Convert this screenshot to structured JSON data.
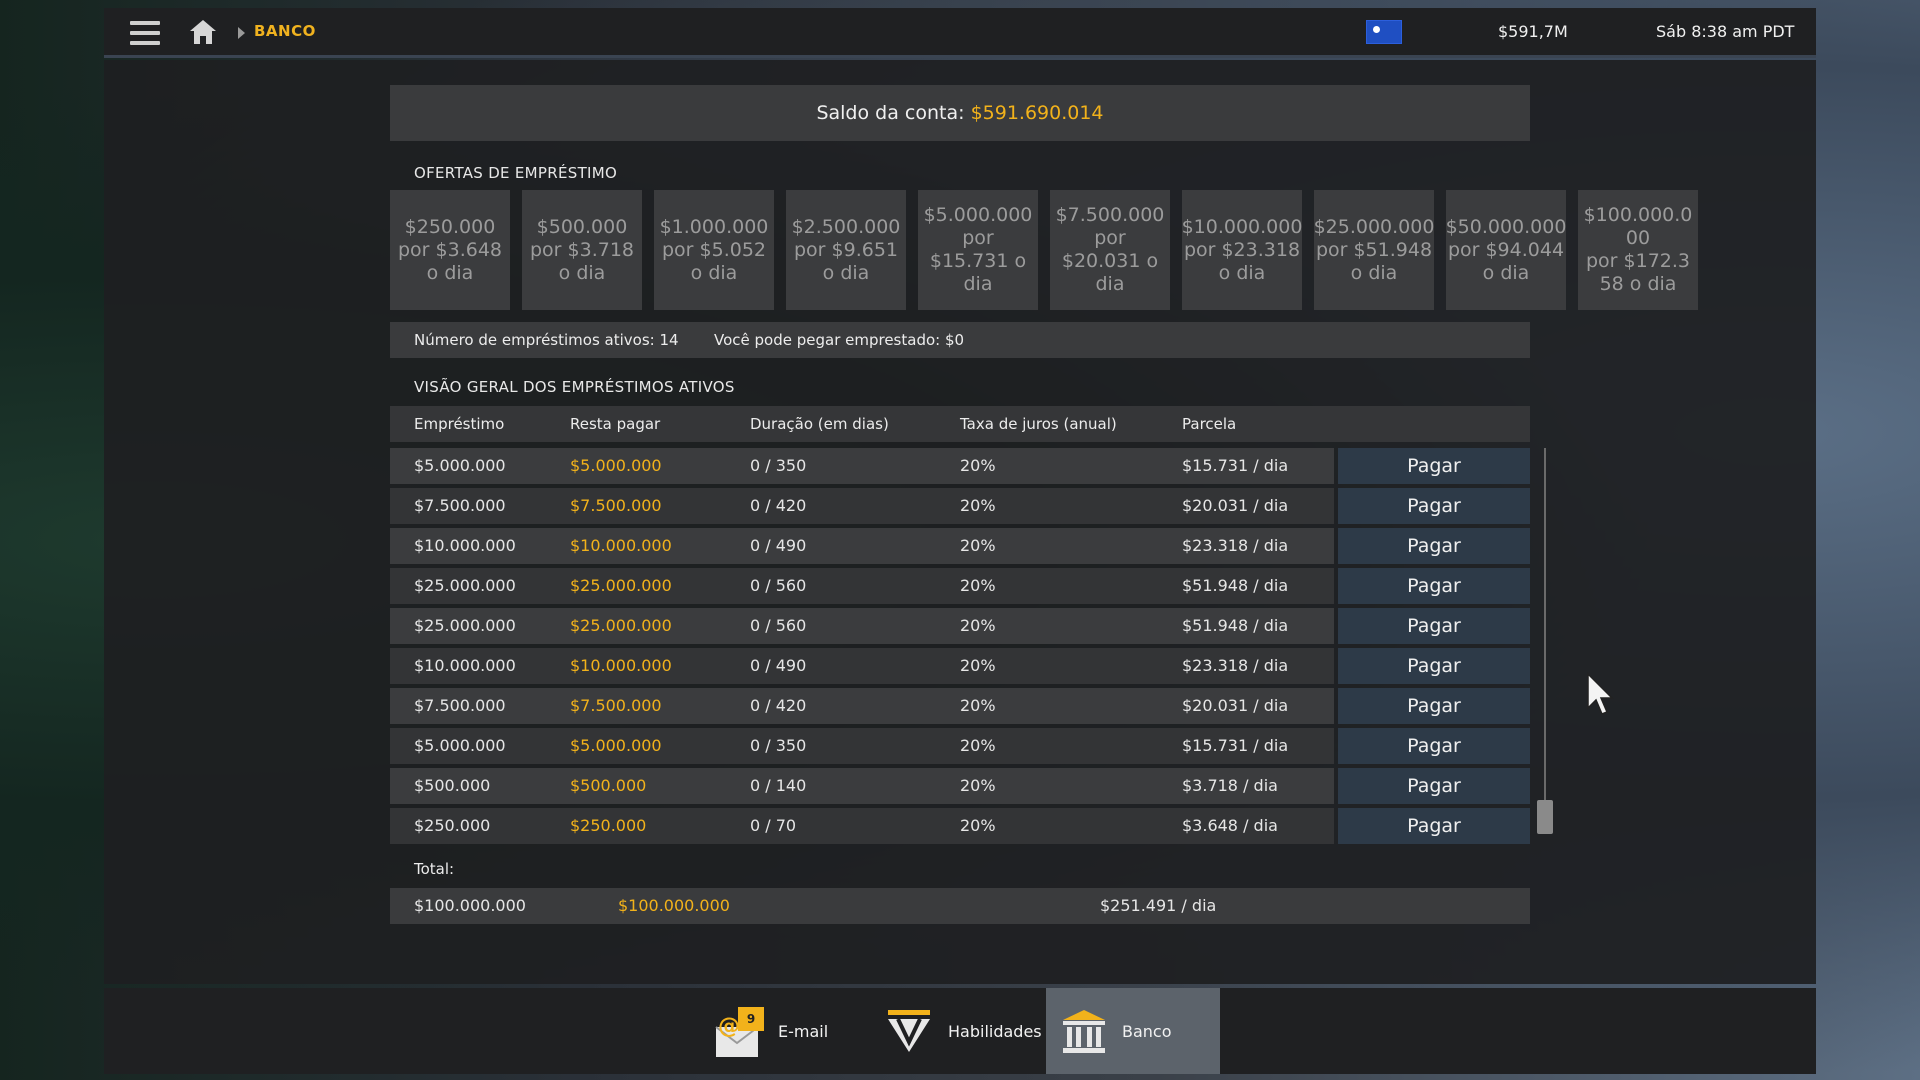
{
  "topbar": {
    "breadcrumb": "BANCO",
    "money": "$591,7M",
    "clock": "Sáb 8:38 am PDT"
  },
  "account": {
    "balance_label": "Saldo da conta: ",
    "balance_value": "$591.690.014"
  },
  "offers_section": {
    "title": "OFERTAS DE EMPRÉSTIMO",
    "offers": [
      {
        "amount": "$250.000",
        "rate": "por $3.648 o dia"
      },
      {
        "amount": "$500.000",
        "rate": "por $3.718 o dia"
      },
      {
        "amount": "$1.000.000",
        "rate": "por $5.052 o dia"
      },
      {
        "amount": "$2.500.000",
        "rate": "por $9.651 o dia"
      },
      {
        "amount": "$5.000.000",
        "rate": "por $15.731 o dia"
      },
      {
        "amount": "$7.500.000",
        "rate": "por $20.031 o dia"
      },
      {
        "amount": "$10.000.000",
        "rate": "por $23.318 o dia"
      },
      {
        "amount": "$25.000.000",
        "rate": "por $51.948 o dia"
      },
      {
        "amount": "$50.000.000",
        "rate": "por $94.044 o dia"
      },
      {
        "amount": "$100.000.000",
        "rate": "por $172.358 o dia"
      }
    ]
  },
  "info": {
    "active_loans": "Número de empréstimos ativos: 14",
    "can_borrow": "Você pode pegar emprestado: $0"
  },
  "loans_section": {
    "title": "VISÃO GERAL DOS EMPRÉSTIMOS ATIVOS",
    "headers": [
      "Empréstimo",
      "Resta pagar",
      "Duração (em dias)",
      "Taxa de juros (anual)",
      "Parcela"
    ],
    "pay_label": "Pagar",
    "rows": [
      [
        "$5.000.000",
        "$5.000.000",
        "0 / 350",
        "20%",
        "$15.731 / dia"
      ],
      [
        "$7.500.000",
        "$7.500.000",
        "0 / 420",
        "20%",
        "$20.031 / dia"
      ],
      [
        "$10.000.000",
        "$10.000.000",
        "0 / 490",
        "20%",
        "$23.318 / dia"
      ],
      [
        "$25.000.000",
        "$25.000.000",
        "0 / 560",
        "20%",
        "$51.948 / dia"
      ],
      [
        "$25.000.000",
        "$25.000.000",
        "0 / 560",
        "20%",
        "$51.948 / dia"
      ],
      [
        "$10.000.000",
        "$10.000.000",
        "0 / 490",
        "20%",
        "$23.318 / dia"
      ],
      [
        "$7.500.000",
        "$7.500.000",
        "0 / 420",
        "20%",
        "$20.031 / dia"
      ],
      [
        "$5.000.000",
        "$5.000.000",
        "0 / 350",
        "20%",
        "$15.731 / dia"
      ],
      [
        "$500.000",
        "$500.000",
        "0 / 140",
        "20%",
        "$3.718 / dia"
      ],
      [
        "$250.000",
        "$250.000",
        "0 / 70",
        "20%",
        "$3.648 / dia"
      ]
    ],
    "total_label": "Total:",
    "total": {
      "loan": "$100.000.000",
      "remaining": "$100.000.000",
      "installment": "$251.491 / dia"
    }
  },
  "dock": {
    "items": [
      {
        "label": "E-mail",
        "badge": "9",
        "icon": "email-icon"
      },
      {
        "label": "Habilidades",
        "icon": "skills-icon"
      },
      {
        "label": "Banco",
        "icon": "bank-icon"
      }
    ]
  },
  "colors": {
    "accent": "#f2b21b",
    "pay_button": "#2d3a48",
    "dock_active": "#5c636b"
  }
}
